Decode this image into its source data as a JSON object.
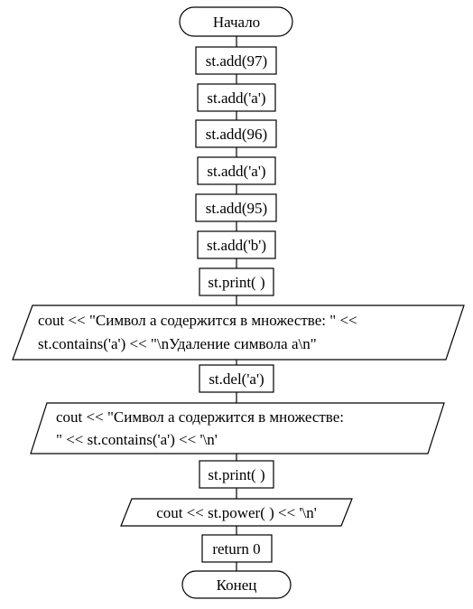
{
  "flowchart": {
    "start": "Начало",
    "steps": [
      {
        "kind": "process",
        "text": "st.add(97)"
      },
      {
        "kind": "process",
        "text": "st.add('a')"
      },
      {
        "kind": "process",
        "text": "st.add(96)"
      },
      {
        "kind": "process",
        "text": "st.add('a')"
      },
      {
        "kind": "process",
        "text": "st.add(95)"
      },
      {
        "kind": "process",
        "text": "st.add('b')"
      },
      {
        "kind": "process",
        "text": "st.print( )"
      },
      {
        "kind": "io",
        "lines": [
          "cout << \"Символ а содержится в множестве: \" <<",
          "st.contains('a') << \"\\nУдаление символа а\\n\""
        ]
      },
      {
        "kind": "process",
        "text": "st.del('a')"
      },
      {
        "kind": "io",
        "lines": [
          "cout << \"Символ а содержится в множестве:",
          "\" << st.contains('a') << '\\n'"
        ]
      },
      {
        "kind": "process",
        "text": "st.print( )"
      },
      {
        "kind": "io",
        "lines": [
          "cout << st.power( ) << '\\n'"
        ]
      },
      {
        "kind": "process",
        "text": "return 0"
      }
    ],
    "end": "Конец"
  }
}
